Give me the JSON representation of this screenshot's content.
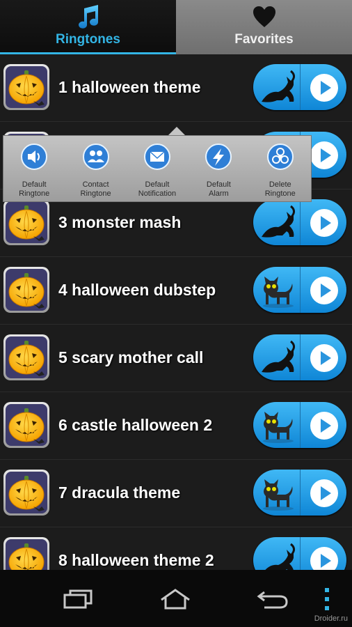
{
  "tabs": [
    {
      "label": "Ringtones",
      "icon": "music-note-icon",
      "active": true
    },
    {
      "label": "Favorites",
      "icon": "heart-icon",
      "active": false
    }
  ],
  "list": [
    {
      "title": "1 halloween theme",
      "cat": "crouching-cat"
    },
    {
      "title": "",
      "cat": "crouching-cat"
    },
    {
      "title": "3 monster mash",
      "cat": "crouching-cat"
    },
    {
      "title": "4 halloween dubstep",
      "cat": "standing-cat"
    },
    {
      "title": "5 scary mother call",
      "cat": "crouching-cat"
    },
    {
      "title": "6 castle halloween 2",
      "cat": "standing-cat"
    },
    {
      "title": "7 dracula theme",
      "cat": "standing-cat"
    },
    {
      "title": "8 halloween theme 2",
      "cat": "crouching-cat"
    }
  ],
  "popup": {
    "items": [
      {
        "label_line1": "Default",
        "label_line2": "Ringtone",
        "icon": "speaker-icon"
      },
      {
        "label_line1": "Contact",
        "label_line2": "Ringtone",
        "icon": "contacts-icon"
      },
      {
        "label_line1": "Default",
        "label_line2": "Notification",
        "icon": "envelope-icon"
      },
      {
        "label_line1": "Default",
        "label_line2": "Alarm",
        "icon": "lightning-icon"
      },
      {
        "label_line1": "Delete",
        "label_line2": "Ringtone",
        "icon": "biohazard-icon"
      }
    ]
  },
  "nav": {
    "recents": "recent-apps-icon",
    "home": "home-icon",
    "back": "back-icon",
    "menu": "overflow-menu-icon"
  },
  "watermark": "Droider.ru",
  "colors": {
    "accent": "#33b5e5",
    "button": "#1f9be6"
  }
}
